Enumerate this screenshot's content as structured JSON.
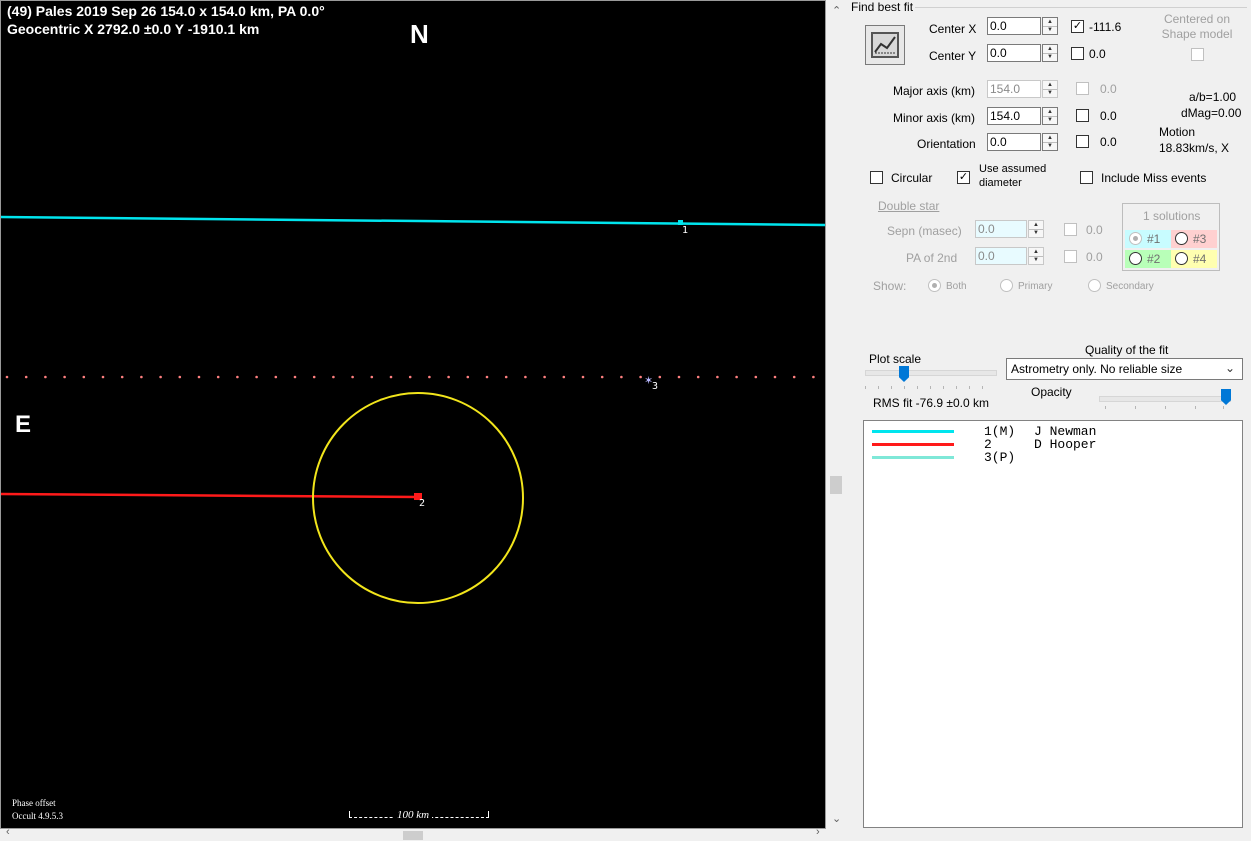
{
  "plot": {
    "title_line1": "(49) Pales  2019 Sep 26  154.0 x 154.0 km, PA 0.0°",
    "title_line2": "Geocentric  X  2792.0 ±0.0  Y -1910.1 km",
    "north_label": "N",
    "east_label": "E",
    "chord_labels": [
      "1",
      "2",
      "3"
    ],
    "footer_line1": "Phase offset",
    "footer_line2": "Occult 4.9.5.3",
    "scale_label": "100 km",
    "colors": {
      "chord1": "#00e5ee",
      "chord2": "#ff1a1a",
      "miss": "#ff8080",
      "ellipse": "#f2e51b",
      "background": "#000000"
    }
  },
  "panel": {
    "find_best_fit_label": "Find best fit",
    "fit_button_icon": "fit-chart-icon",
    "center_x": {
      "label": "Center X",
      "value": "0.0",
      "fit_checked": true,
      "fit_value": "-111.6"
    },
    "center_y": {
      "label": "Center Y",
      "value": "0.0",
      "fit_checked": false,
      "fit_value": "0.0"
    },
    "centered_on_shape_label": "Centered on\nShape model",
    "major_axis": {
      "label": "Major axis (km)",
      "value": "154.0",
      "fit_value": "0.0"
    },
    "minor_axis": {
      "label": "Minor axis (km)",
      "value": "154.0",
      "fit_value": "0.0"
    },
    "orientation": {
      "label": "Orientation",
      "value": "0.0",
      "fit_value": "0.0"
    },
    "ab_ratio": "a/b=1.00",
    "dmag": "dMag=0.00",
    "motion_label": "Motion",
    "motion_value": "18.83km/s, X",
    "circular_label": "Circular",
    "use_assumed_label": "Use assumed\ndiameter",
    "include_miss_label": "Include Miss events",
    "double_star_label": "Double star",
    "sepn_label": "Sepn (masec)",
    "sepn_value": "0.0",
    "sepn_fit_value": "0.0",
    "pa2_label": "PA of 2nd",
    "pa2_value": "0.0",
    "pa2_fit_value": "0.0",
    "show_label": "Show:",
    "show_options": [
      "Both",
      "Primary",
      "Secondary"
    ],
    "solutions_title": "1 solutions",
    "solutions": [
      "#1",
      "#3",
      "#2",
      "#4"
    ],
    "plot_scale_label": "Plot scale",
    "quality_label": "Quality of the fit",
    "quality_value": "Astrometry only. No reliable size",
    "opacity_label": "Opacity",
    "rms_fit": "RMS fit -76.9 ±0.0 km",
    "legend": [
      {
        "num": "1(M)",
        "name": "J Newman",
        "color": "#00e5ee"
      },
      {
        "num": "2",
        "name": "D Hooper",
        "color": "#ff1a1a"
      },
      {
        "num": "3(P)",
        "name": "",
        "color": "#7fe8d8"
      }
    ]
  }
}
